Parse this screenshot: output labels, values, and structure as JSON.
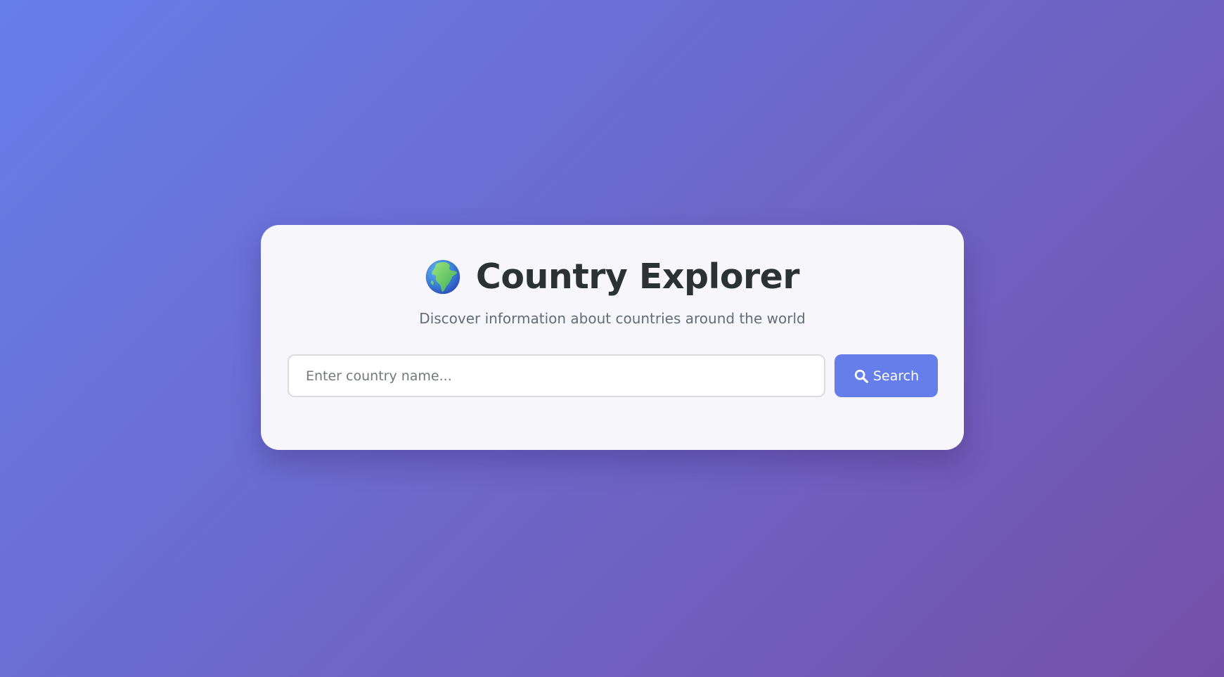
{
  "app": {
    "title": "Country Explorer",
    "subtitle": "Discover information about countries around the world",
    "title_icon": "globe-europe-africa-icon"
  },
  "search": {
    "placeholder": "Enter country name...",
    "value": "",
    "button_label": "Search",
    "button_icon": "search-icon"
  },
  "colors": {
    "background_gradient_start": "#667eea",
    "background_gradient_end": "#7450a9",
    "card_background": "#f7f7fb",
    "accent": "#667eea",
    "title_text": "#2a3232",
    "subtitle_text": "#636c74"
  }
}
